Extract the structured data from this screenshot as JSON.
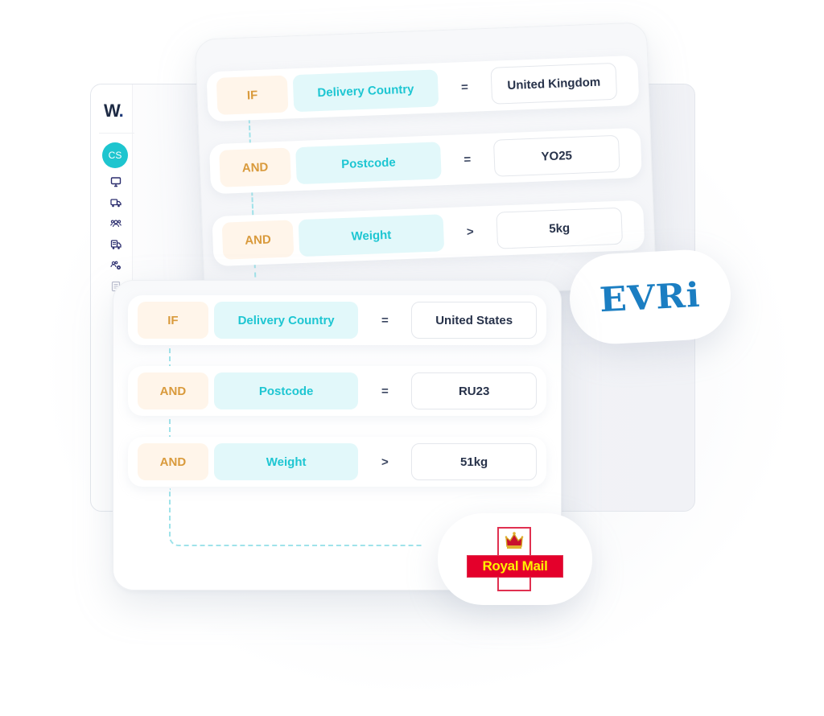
{
  "app": {
    "logo_text": "W",
    "logo_dot": ".",
    "avatar_initials": "CS",
    "nav_icons": [
      "monitor-icon",
      "truck-icon",
      "users-icon",
      "delivery-truck-icon",
      "users-settings-icon",
      "document-icon"
    ]
  },
  "rules_top": {
    "carrier": "EVRi",
    "rows": [
      {
        "logic": "IF",
        "field": "Delivery Country",
        "operator": "=",
        "value": "United Kingdom"
      },
      {
        "logic": "AND",
        "field": "Postcode",
        "operator": "=",
        "value": "YO25"
      },
      {
        "logic": "AND",
        "field": "Weight",
        "operator": ">",
        "value": "5kg"
      }
    ]
  },
  "rules_bottom": {
    "carrier": "Royal Mail",
    "rows": [
      {
        "logic": "IF",
        "field": "Delivery Country",
        "operator": "=",
        "value": "United States"
      },
      {
        "logic": "AND",
        "field": "Postcode",
        "operator": "=",
        "value": "RU23"
      },
      {
        "logic": "AND",
        "field": "Weight",
        "operator": ">",
        "value": "51kg"
      }
    ]
  },
  "colors": {
    "logic_bg": "#fff5ea",
    "logic_text": "#d99a3c",
    "field_bg": "#e2f8fa",
    "field_text": "#1ec6d2",
    "value_text": "#27324a",
    "avatar": "#1ec5cf",
    "evri_blue": "#1b7ec2",
    "royal_mail_red": "#e4002b",
    "royal_mail_yellow": "#fff200"
  }
}
